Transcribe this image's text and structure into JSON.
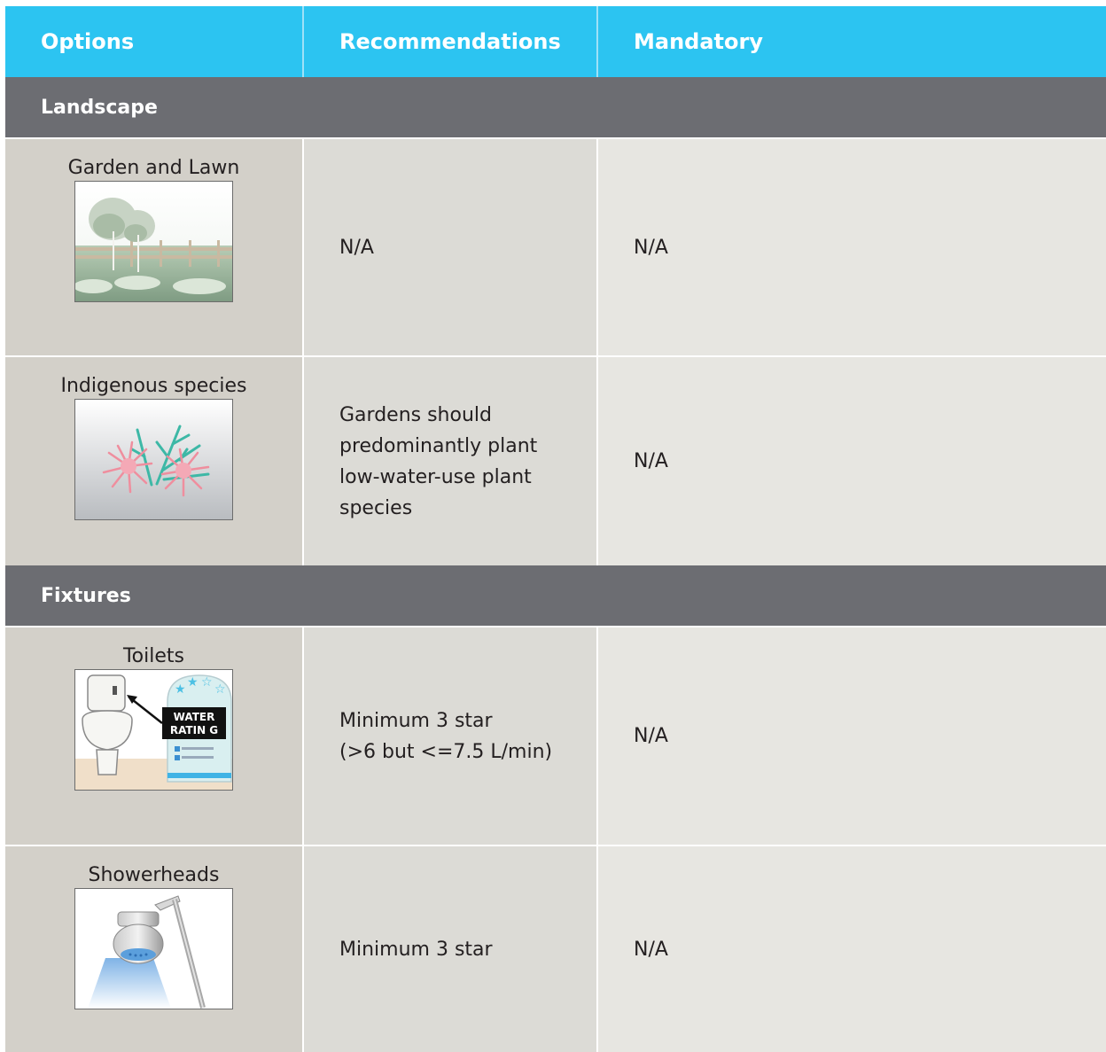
{
  "table": {
    "headers": {
      "options": "Options",
      "recommendations": "Recommendations",
      "mandatory": "Mandatory"
    },
    "sections": [
      {
        "title": "Landscape",
        "rows": [
          {
            "option": "Garden and Lawn",
            "icon": "garden-lawn-icon",
            "recommendation": "N/A",
            "mandatory": "N/A"
          },
          {
            "option": "Indigenous species",
            "icon": "indigenous-plant-icon",
            "recommendation": "Gardens should predominantly plant low-water-use plant species",
            "mandatory": "N/A"
          }
        ]
      },
      {
        "title": "Fixtures",
        "rows": [
          {
            "option": "Toilets",
            "icon": "toilet-water-rating-icon",
            "recommendation_lines": [
              "Minimum 3 star",
              "(>6 but <=7.5 L/min)"
            ],
            "mandatory": "N/A",
            "icon_text": [
              "WATER",
              "RATIN G"
            ]
          },
          {
            "option": "Showerheads",
            "icon": "showerhead-icon",
            "recommendation": "Minimum 3 star",
            "mandatory": "N/A"
          }
        ]
      }
    ]
  },
  "colors": {
    "header": "#2cc4f1",
    "section": "#6c6d72",
    "col_options": "#d3d0c9",
    "col_recommendations": "#dcdbd6",
    "col_mandatory": "#e7e6e1"
  }
}
